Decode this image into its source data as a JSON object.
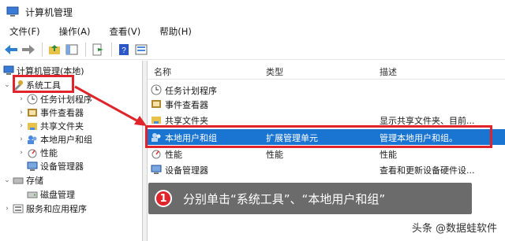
{
  "window": {
    "title": "计算机管理"
  },
  "menu": {
    "file": "文件(F)",
    "action": "操作(A)",
    "view": "查看(V)",
    "help": "帮助(H)"
  },
  "toolbar": {
    "back": "arrow-left-icon",
    "forward": "arrow-right-icon"
  },
  "tree": {
    "root": "计算机管理(本地)",
    "system_tools": "系统工具",
    "task_scheduler": "任务计划程序",
    "event_viewer": "事件查看器",
    "shared_folders": "共享文件夹",
    "local_users": "本地用户和组",
    "performance": "性能",
    "device_manager": "设备管理器",
    "storage": "存储",
    "disk_mgmt": "磁盘管理",
    "services": "服务和应用程序"
  },
  "list": {
    "col_name": "名称",
    "col_type": "类型",
    "col_desc": "描述",
    "rows": [
      {
        "name": "任务计划程序",
        "type": "",
        "desc": ""
      },
      {
        "name": "事件查看器",
        "type": "",
        "desc": ""
      },
      {
        "name": "共享文件夹",
        "type": "",
        "desc": "显示共享文件夹、目前..."
      },
      {
        "name": "本地用户和组",
        "type": "扩展管理单元",
        "desc": "管理本地用户和组。"
      },
      {
        "name": "性能",
        "type": "性能",
        "desc": "性能"
      },
      {
        "name": "设备管理器",
        "type": "",
        "desc": "查看和更新设备硬件设..."
      }
    ]
  },
  "annotation": {
    "number": "1",
    "text": "分别单击“系统工具”、“本地用户和组”"
  },
  "watermark": "头条 @数据蛙软件",
  "colors": {
    "highlight": "#1a75d2",
    "annotation_red": "#e0242b",
    "callout_bg": "#6b6b6b"
  }
}
